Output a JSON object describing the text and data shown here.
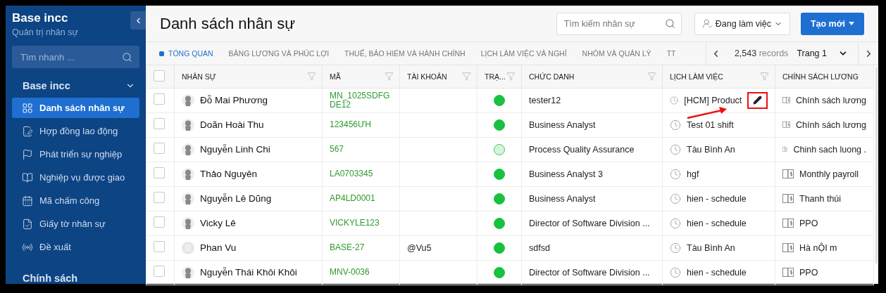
{
  "sidebar": {
    "title": "Base incc",
    "subtitle": "Quản trị nhân sự",
    "search": {
      "placeholder": "Tìm nhanh ..."
    },
    "section": {
      "label": "Base incc",
      "expanded": true
    },
    "items": [
      {
        "label": "Danh sách nhân sự",
        "selected": true
      },
      {
        "label": "Hợp đồng lao động",
        "selected": false
      },
      {
        "label": "Phát triển sự nghiệp",
        "selected": false
      },
      {
        "label": "Nghiệp vụ được giao",
        "selected": false
      },
      {
        "label": "Mã chấm công",
        "selected": false
      },
      {
        "label": "Giấy tờ nhân sự",
        "selected": false
      },
      {
        "label": "Đề xuất",
        "selected": false
      }
    ],
    "next_section": "Chính sách"
  },
  "page": {
    "title": "Danh sách nhân sự",
    "search": {
      "placeholder": "Tìm kiếm nhân sự"
    },
    "status_filter": "Đang làm việc",
    "create_button": "Tạo mới"
  },
  "tabs": [
    {
      "label": "TỔNG QUAN",
      "selected": true
    },
    {
      "label": "BẢNG LƯƠNG VÀ PHÚC LỢI",
      "selected": false
    },
    {
      "label": "THUẾ, BẢO HIỂM VÀ HÀNH CHÍNH",
      "selected": false
    },
    {
      "label": "LỊCH LÀM VIỆC VÀ NGHỈ",
      "selected": false
    },
    {
      "label": "NHÓM VÀ QUẢN LÝ",
      "selected": false
    },
    {
      "label": "TT",
      "selected": false
    }
  ],
  "pager": {
    "count": "2,543",
    "unit": "records",
    "page": "Trang 1"
  },
  "table": {
    "select_all_checked": false,
    "columns": [
      "NHÂN SỰ",
      "MÃ",
      "TÀI KHOẢN",
      "TRẠ...",
      "CHỨC DANH",
      "LỊCH LÀM VIỆC",
      "CHÍNH SÁCH LƯƠNG"
    ],
    "rows": [
      {
        "checked": false,
        "has_photo": true,
        "name": "Đỗ Mai Phương",
        "code": "MN_1025SDFGDE12",
        "account": "",
        "active": true,
        "title": "tester12",
        "schedule": "[HCM] Product",
        "edit_highlighted": true,
        "policy": "Chính sách lương"
      },
      {
        "checked": false,
        "has_photo": true,
        "name": "Doãn Hoài Thu",
        "code": "123456ƯH",
        "account": "",
        "active": true,
        "title": "Business Analyst",
        "schedule": "Test 01 shift",
        "edit_highlighted": false,
        "policy": "Chính sách lương"
      },
      {
        "checked": false,
        "has_photo": true,
        "name": "Nguyễn Linh Chi",
        "code": "567",
        "account": "",
        "active": false,
        "title": "Process Quality Assurance",
        "schedule": "Tàu Bình An",
        "edit_highlighted": false,
        "policy": "Chinh sach luong ."
      },
      {
        "checked": false,
        "has_photo": true,
        "name": "Thảo Nguyên",
        "code": "LA0703345",
        "account": "",
        "active": true,
        "title": "Business Analyst 3",
        "schedule": "hgf",
        "edit_highlighted": false,
        "policy": "Monthly payroll"
      },
      {
        "checked": false,
        "has_photo": true,
        "name": "Nguyễn Lê Dũng",
        "code": "AP4LD0001",
        "account": "",
        "active": true,
        "title": "Business Analyst",
        "schedule": "hien - schedule",
        "edit_highlighted": false,
        "policy": "Thanh thúi"
      },
      {
        "checked": false,
        "has_photo": true,
        "name": "Vicky Lê",
        "code": "VICKYLE123",
        "account": "",
        "active": true,
        "title": "Director of Software Division ...",
        "schedule": "hien - schedule",
        "edit_highlighted": false,
        "policy": "PPO"
      },
      {
        "checked": false,
        "has_photo": false,
        "name": "Phan Vu",
        "code": "BASE-27",
        "account": "@Vu5",
        "active": true,
        "title": "sdfsd",
        "schedule": "Tàu Bình An",
        "edit_highlighted": false,
        "policy": "Hà nỘI m"
      },
      {
        "checked": false,
        "has_photo": true,
        "name": "Nguyễn Thái Khôi Khôi",
        "code": "MNV-0036",
        "account": "",
        "active": true,
        "title": "Director of Software Division ...",
        "schedule": "hien - schedule",
        "edit_highlighted": false,
        "policy": "PPO"
      }
    ]
  }
}
